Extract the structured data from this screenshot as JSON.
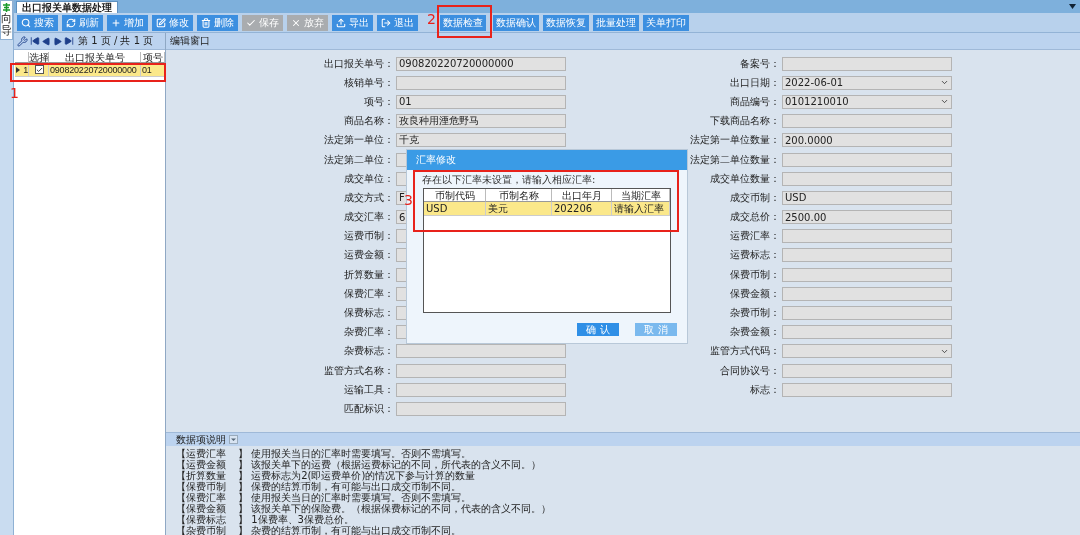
{
  "sidebar": {
    "label": "向导"
  },
  "tab": {
    "title": "出口报关单数据处理"
  },
  "toolbar": {
    "edit_buttons": [
      {
        "label": "搜索",
        "disabled": false
      },
      {
        "label": "刷新",
        "disabled": false
      },
      {
        "label": "增加",
        "disabled": false
      },
      {
        "label": "修改",
        "disabled": false
      },
      {
        "label": "删除",
        "disabled": false
      },
      {
        "label": "保存",
        "disabled": true
      },
      {
        "label": "放弃",
        "disabled": true
      },
      {
        "label": "导出",
        "disabled": false
      },
      {
        "label": "退出",
        "disabled": false
      }
    ],
    "data_buttons": [
      "数据检查",
      "数据确认",
      "数据恢复",
      "批量处理",
      "关单打印"
    ]
  },
  "list_panel": {
    "pager": "第 1 页 / 共 1 页",
    "columns": [
      "选择",
      "出口报关单号",
      "项号"
    ],
    "rows": [
      {
        "index": "1",
        "checked": true,
        "number": "090820220720000000",
        "item": "01",
        "selected": true
      }
    ]
  },
  "edit_panel": {
    "title": "编辑窗口",
    "left_fields": [
      {
        "label": "出口报关单号：",
        "value": "090820220720000000",
        "kind": "text"
      },
      {
        "label": "核销单号：",
        "kind": "text"
      },
      {
        "label": "项号：",
        "value": "01",
        "kind": "text"
      },
      {
        "label": "商品名称：",
        "value": "孜良种用湮危野马",
        "kind": "text"
      },
      {
        "label": "法定第一单位：",
        "value": "千克",
        "kind": "text"
      },
      {
        "label": "法定第二单位：",
        "kind": "text"
      },
      {
        "label": "成交单位：",
        "kind": "text"
      },
      {
        "label": "成交方式：",
        "value": "F",
        "kind": "text"
      },
      {
        "label": "成交汇率：",
        "value": "6",
        "kind": "text"
      },
      {
        "label": "运费币制：",
        "kind": "text"
      },
      {
        "label": "运费金额：",
        "kind": "text"
      },
      {
        "label": "折算数量：",
        "kind": "text"
      },
      {
        "label": "保费汇率：",
        "kind": "text"
      },
      {
        "label": "保费标志：",
        "kind": "text"
      },
      {
        "label": "杂费汇率：",
        "kind": "text"
      },
      {
        "label": "杂费标志：",
        "kind": "text"
      },
      {
        "label": "监管方式名称：",
        "kind": "text"
      },
      {
        "label": "运输工具：",
        "kind": "text"
      },
      {
        "label": "匹配标识：",
        "kind": "text"
      }
    ],
    "right_fields": [
      {
        "label": "备案号：",
        "kind": "text"
      },
      {
        "label": "出口日期：",
        "value": "2022-06-01",
        "kind": "select"
      },
      {
        "label": "商品编号：",
        "value": "0101210010",
        "kind": "select"
      },
      {
        "label": "下载商品名称：",
        "kind": "text"
      },
      {
        "label": "法定第一单位数量：",
        "value": "200.0000",
        "kind": "text"
      },
      {
        "label": "法定第二单位数量：",
        "kind": "text"
      },
      {
        "label": "成交单位数量：",
        "kind": "text"
      },
      {
        "label": "成交币制：",
        "value": "USD",
        "kind": "text"
      },
      {
        "label": "成交总价：",
        "value": "2500.00",
        "kind": "text"
      },
      {
        "label": "运费汇率：",
        "kind": "text"
      },
      {
        "label": "运费标志：",
        "kind": "text"
      },
      {
        "label": "保费币制：",
        "kind": "text"
      },
      {
        "label": "保费金额：",
        "kind": "text"
      },
      {
        "label": "杂费币制：",
        "kind": "text"
      },
      {
        "label": "杂费金额：",
        "kind": "text"
      },
      {
        "label": "监管方式代码：",
        "kind": "select"
      },
      {
        "label": "合同协议号：",
        "kind": "text"
      },
      {
        "label": "标志：",
        "kind": "text"
      }
    ]
  },
  "dialog": {
    "title": "汇率修改",
    "message": "存在以下汇率未设置，请输入相应汇率:",
    "columns": [
      "币制代码",
      "币制名称",
      "出口年月",
      "当期汇率"
    ],
    "rows": [
      {
        "cells": [
          "USD",
          "美元",
          "202206",
          "请输入汇率"
        ],
        "selected": true
      }
    ],
    "buttons": [
      {
        "label": "确 认",
        "primary": true
      },
      {
        "label": "取 消",
        "primary": false
      }
    ]
  },
  "notes": {
    "title": "数据项说明",
    "lines": [
      {
        "term": "【运费汇率",
        "text": "】 使用报关当日的汇率时需要填写。否则不需填写。"
      },
      {
        "term": "【运费金额",
        "text": "】 该报关单下的运费（根据运费标记的不同，所代表的含义不同。）"
      },
      {
        "term": "【折算数量",
        "text": "】 运费标志为2(即运费单价)的情况下参与计算的数量"
      },
      {
        "term": "【保费币制",
        "text": "】 保费的结算币制，有可能与出口成交币制不同。"
      },
      {
        "term": "【保费汇率",
        "text": "】 使用报关当日的汇率时需要填写。否则不需填写。"
      },
      {
        "term": "【保费金额",
        "text": "】 该报关单下的保险费。（根据保费标记的不同，代表的含义不同。）"
      },
      {
        "term": "【保费标志",
        "text": "】 1保费率、3保费总价。"
      },
      {
        "term": "【杂费币制",
        "text": "】 杂费的结算币制，有可能与出口成交币制不同。"
      }
    ]
  },
  "annotations": [
    {
      "label": "1"
    },
    {
      "label": "2"
    },
    {
      "label": "3"
    }
  ]
}
